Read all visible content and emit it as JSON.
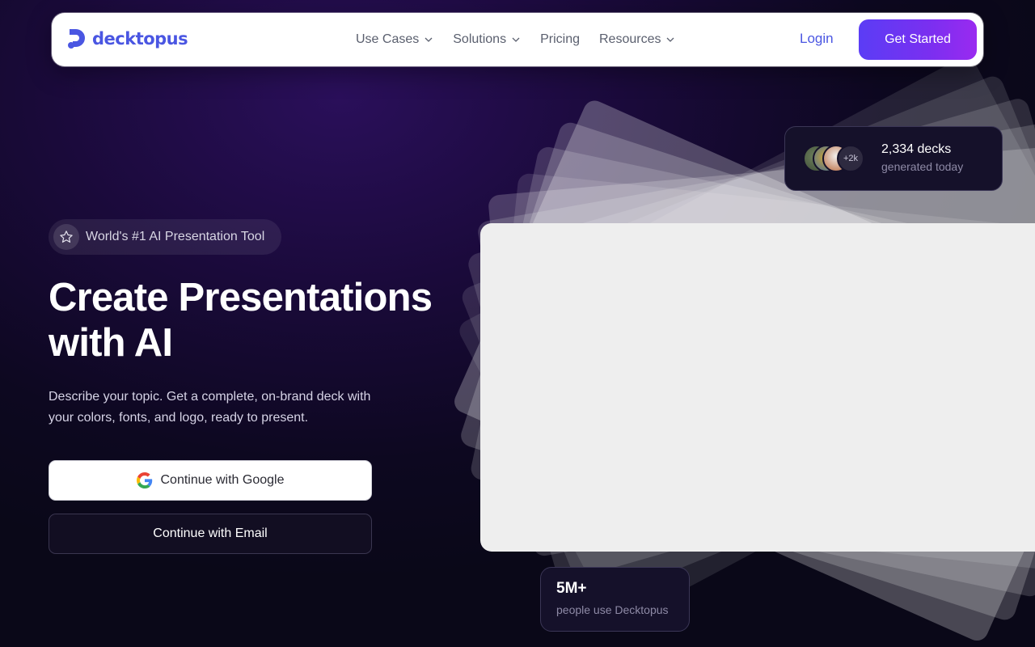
{
  "nav": {
    "brand": "decktopus",
    "links": [
      "Use Cases",
      "Solutions",
      "Pricing",
      "Resources"
    ],
    "login": "Login",
    "cta": "Get Started"
  },
  "hero": {
    "badge": "World's #1 AI Presentation Tool",
    "title_line1": "Create Presentations",
    "title_line2": "with AI",
    "subtitle": "Describe your topic. Get a complete, on-brand deck with your colors, fonts, and logo, ready to present.",
    "google_button": "Continue with Google",
    "email_button": "Continue with Email"
  },
  "stats": {
    "top": {
      "avatars_more": "+2k",
      "count": "2,334 decks",
      "label": "generated today"
    },
    "bottom": {
      "count": "5M+",
      "label": "people use Decktopus"
    }
  },
  "colors": {
    "brand": "#4a56e2",
    "cta_start": "#5b3df5",
    "cta_end": "#9a2af0",
    "background": "#0d0820"
  }
}
